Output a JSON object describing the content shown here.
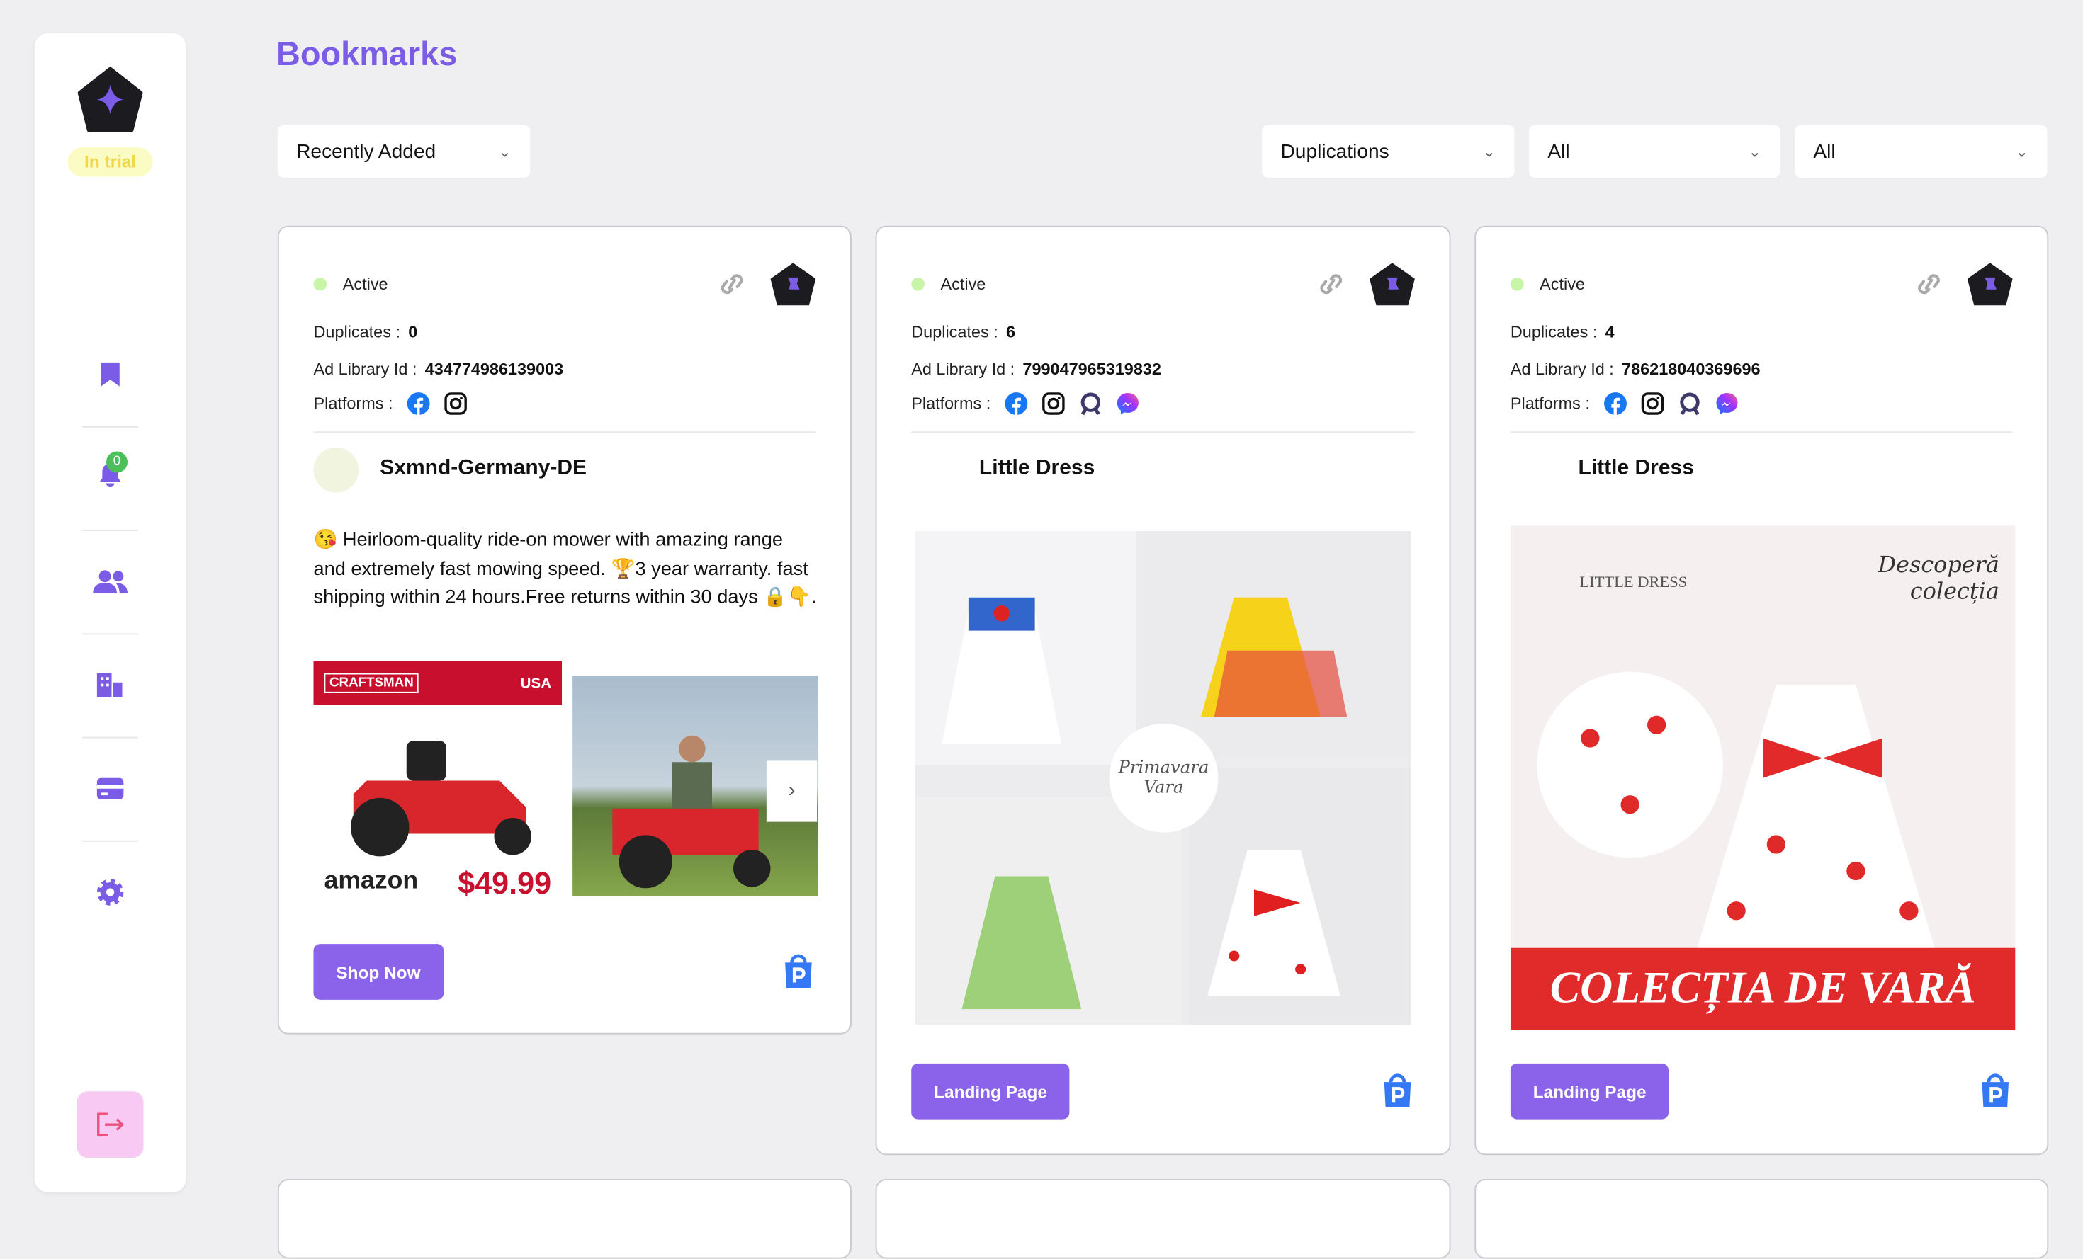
{
  "sidebar": {
    "trial_badge": "In trial",
    "notification_count": "0",
    "items": [
      "bookmarks",
      "notifications",
      "users",
      "buildings",
      "billing",
      "settings"
    ]
  },
  "page": {
    "title": "Bookmarks"
  },
  "filters": {
    "sort": "Recently Added",
    "duplications": "Duplications",
    "filter2": "All",
    "filter3": "All"
  },
  "colors": {
    "accent": "#7b5ce6",
    "button": "#8a63ea",
    "active_dot": "#c9f5a8",
    "trial_bg": "#fbfcc4",
    "logout_bg": "#f7c9f3"
  },
  "labels": {
    "duplicates": "Duplicates :",
    "ad_library_id": "Ad Library Id :",
    "platforms": "Platforms :"
  },
  "cards": [
    {
      "status": "Active",
      "duplicates": "0",
      "ad_library_id": "434774986139003",
      "platforms": [
        "facebook",
        "instagram"
      ],
      "page_name": "Sxmnd-Germany-DE",
      "copy": "😘 Heirloom-quality ride-on mower with amazing range and extremely fast mowing speed. 🏆3 year warranty. fast shipping within 24 hours.Free returns within 30 days 🔒👇.",
      "image_text": {
        "brand": "CRAFTSMAN",
        "store": "amazon",
        "price": "$49.99",
        "flag": "USA"
      },
      "cta": "Shop Now"
    },
    {
      "status": "Active",
      "duplicates": "6",
      "ad_library_id": "799047965319832",
      "platforms": [
        "facebook",
        "instagram",
        "audience-network",
        "messenger"
      ],
      "page_name": "Little Dress",
      "image_text": {
        "script": "Primavara Vara"
      },
      "cta": "Landing Page"
    },
    {
      "status": "Active",
      "duplicates": "4",
      "ad_library_id": "786218040369696",
      "platforms": [
        "facebook",
        "instagram",
        "audience-network",
        "messenger"
      ],
      "page_name": "Little Dress",
      "image_text": {
        "brand": "LITTLE DRESS",
        "script": "Descoperă colecția",
        "banner": "COLECȚIA DE VARĂ"
      },
      "cta": "Landing Page"
    }
  ]
}
